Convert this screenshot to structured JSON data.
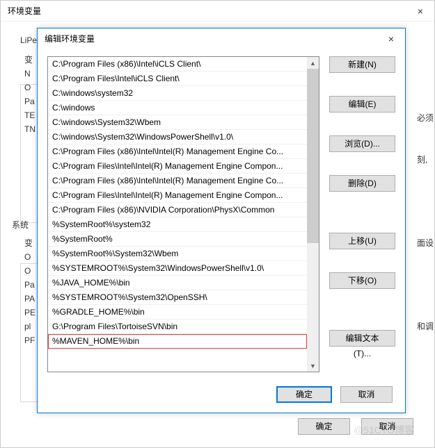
{
  "outer": {
    "title": "环境变量",
    "close": "×",
    "lipe": "LiPe",
    "col_labels": [
      "变",
      "N",
      "O",
      "Pa",
      "TE",
      "TN"
    ],
    "section2": "系统",
    "col2_labels": [
      "变",
      "O",
      "O",
      "Pa",
      "PA",
      "PE",
      "pl",
      "PF"
    ],
    "right_labels": [
      "必须",
      "刻,",
      "面设",
      "和调"
    ],
    "ok": "确定",
    "cancel": "取消"
  },
  "inner": {
    "title": "编辑环境变量",
    "close": "×",
    "items": [
      "C:\\Program Files (x86)\\Intel\\iCLS Client\\",
      "C:\\Program Files\\Intel\\iCLS Client\\",
      "C:\\windows\\system32",
      "C:\\windows",
      "C:\\windows\\System32\\Wbem",
      "C:\\windows\\System32\\WindowsPowerShell\\v1.0\\",
      "C:\\Program Files (x86)\\Intel\\Intel(R) Management Engine Co...",
      "C:\\Program Files\\Intel\\Intel(R) Management Engine Compon...",
      "C:\\Program Files (x86)\\Intel\\Intel(R) Management Engine Co...",
      "C:\\Program Files\\Intel\\Intel(R) Management Engine Compon...",
      "C:\\Program Files (x86)\\NVIDIA Corporation\\PhysX\\Common",
      "%SystemRoot%\\system32",
      "%SystemRoot%",
      "%SystemRoot%\\System32\\Wbem",
      "%SYSTEMROOT%\\System32\\WindowsPowerShell\\v1.0\\",
      "%JAVA_HOME%\\bin",
      "%SYSTEMROOT%\\System32\\OpenSSH\\",
      "%GRADLE_HOME%\\bin",
      "G:\\Program Files\\TortoiseSVN\\bin",
      "%MAVEN_HOME%\\bin"
    ],
    "highlight_index": 19,
    "buttons": {
      "new": "新建(N)",
      "edit": "编辑(E)",
      "browse": "浏览(D)...",
      "delete": "删除(D)",
      "moveup": "上移(U)",
      "movedown": "下移(O)",
      "edittext": "编辑文本(T)..."
    },
    "ok": "确定",
    "cancel": "取消"
  },
  "watermark": "@51CTO博客"
}
